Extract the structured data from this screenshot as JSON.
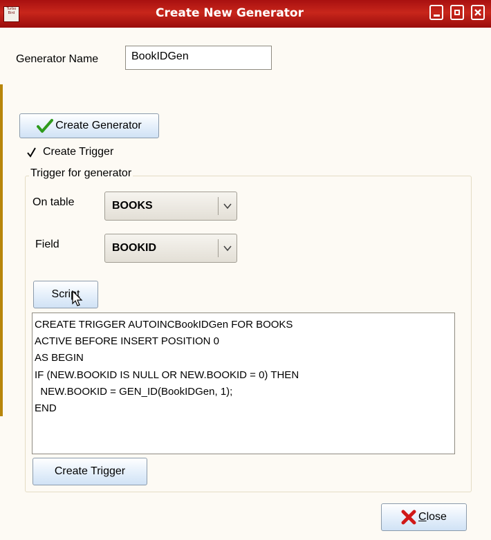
{
  "window": {
    "title": "Create New Generator",
    "icon_text": "Turbo Bird",
    "controls": [
      "minimize-icon",
      "maximize-icon",
      "close-icon"
    ]
  },
  "generator": {
    "label": "Generator Name",
    "value": "BookIDGen",
    "create_button": "Create Generator"
  },
  "trigger_checkbox": {
    "label": "Create Trigger",
    "checked": true
  },
  "trigger_group": {
    "title": "Trigger for generator",
    "table_label": "On table",
    "table_value": "BOOKS",
    "field_label": "Field",
    "field_value": "BOOKID",
    "script_button": "Script",
    "script_text": "CREATE TRIGGER AUTOINCBookIDGen FOR BOOKS\nACTIVE BEFORE INSERT POSITION 0\nAS BEGIN\nIF (NEW.BOOKID IS NULL OR NEW.BOOKID = 0) THEN\n  NEW.BOOKID = GEN_ID(BookIDGen, 1);\nEND",
    "create_trigger_button": "Create Trigger"
  },
  "close_button": {
    "mnemonic": "C",
    "rest": "lose"
  },
  "colors": {
    "titlebar": "#b51a14",
    "accent_check": "#2e9a1c",
    "close_x": "#d01818",
    "button_face": "#dbe8f7"
  }
}
